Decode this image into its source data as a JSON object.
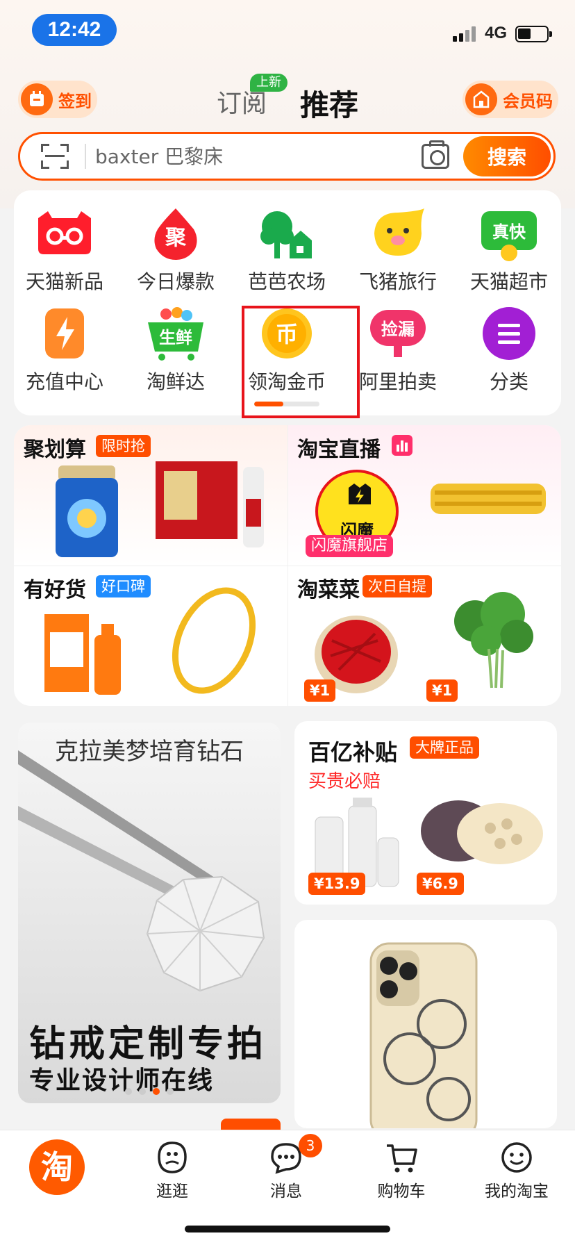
{
  "status": {
    "time": "12:42",
    "network": "4G"
  },
  "header": {
    "sign_label": "签到",
    "tab_subscribe": "订阅",
    "tab_subscribe_badge": "上新",
    "tab_recommend": "推荐",
    "member_label": "会员码"
  },
  "search": {
    "placeholder": "baxter 巴黎床",
    "button": "搜索"
  },
  "categories": [
    {
      "label": "天猫新品",
      "icon": "tmall-cat-icon"
    },
    {
      "label": "今日爆款",
      "icon": "flame-ju-icon",
      "icon_text": "聚"
    },
    {
      "label": "芭芭农场",
      "icon": "farm-tree-icon"
    },
    {
      "label": "飞猪旅行",
      "icon": "fliggy-pig-icon"
    },
    {
      "label": "天猫超市",
      "icon": "tmall-supermarket-icon",
      "icon_text": "真快"
    },
    {
      "label": "充值中心",
      "icon": "lightning-icon"
    },
    {
      "label": "淘鲜达",
      "icon": "fresh-cart-icon",
      "icon_text": "生鲜"
    },
    {
      "label": "领淘金币",
      "icon": "gold-coin-icon",
      "icon_text": "币"
    },
    {
      "label": "阿里拍卖",
      "icon": "auction-icon",
      "icon_text": "捡漏"
    },
    {
      "label": "分类",
      "icon": "menu-icon"
    }
  ],
  "coin_progress": 0.45,
  "promos": [
    {
      "title": "聚划算",
      "tag": "限时抢",
      "tag_color": "#ff4e00"
    },
    {
      "title": "淘宝直播",
      "tag_icon": "live-bars-icon",
      "shop_label": "闪魔旗舰店",
      "shop_logo_text": "闪魔"
    },
    {
      "title": "有好货",
      "tag": "好口碑",
      "tag_color": "#1f8cff"
    },
    {
      "title": "淘菜菜",
      "tag": "次日自提",
      "tag_color": "#ff4e00",
      "prices": [
        "¥1",
        "¥1"
      ]
    }
  ],
  "feed": {
    "left": {
      "title": "克拉美梦培育钻石",
      "headline": "钻戒定制专拍",
      "subline": "专业设计师在线"
    },
    "right_top": {
      "title": "百亿补贴",
      "tag": "大牌正品",
      "subtitle": "买贵必赔",
      "prices": [
        "¥13.9",
        "¥6.9"
      ]
    }
  },
  "tabbar": {
    "home_logo": "淘",
    "items": [
      {
        "label": "逛逛"
      },
      {
        "label": "消息",
        "badge": "3"
      },
      {
        "label": "购物车"
      },
      {
        "label": "我的淘宝"
      }
    ]
  }
}
